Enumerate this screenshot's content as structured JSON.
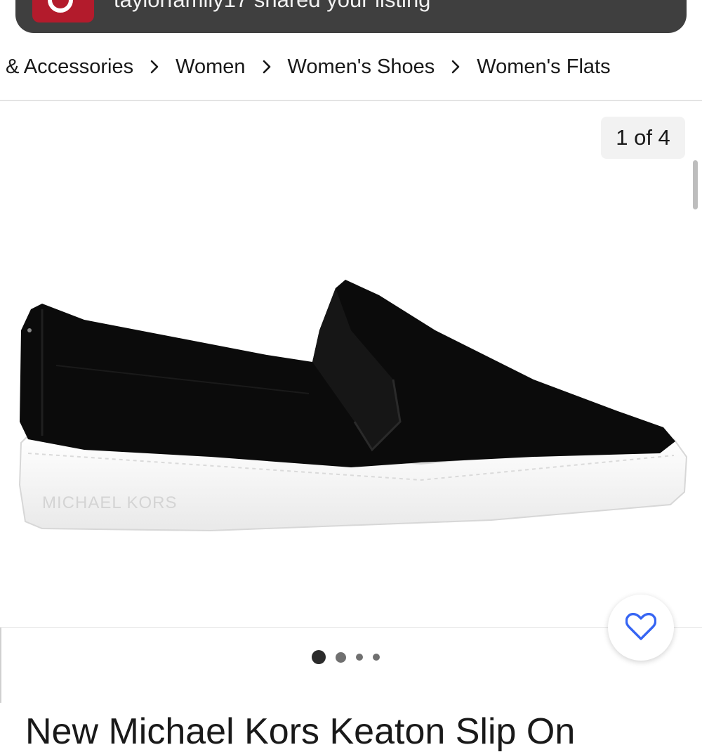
{
  "notification": {
    "text": "taylorfamily17 shared your listing"
  },
  "breadcrumb": [
    {
      "label": "& Accessories"
    },
    {
      "label": "Women"
    },
    {
      "label": "Women's Shoes"
    },
    {
      "label": "Women's Flats"
    }
  ],
  "gallery": {
    "counter": "1 of 4",
    "current_index": 1,
    "total": 4,
    "image_brand_text": "MICHAEL KORS"
  },
  "listing": {
    "title": "New Michael Kors Keaton Slip On"
  },
  "icons": {
    "notification_app": "app-icon",
    "breadcrumb_separator": "chevron-right-icon",
    "favorite": "heart-icon"
  },
  "colors": {
    "banner_bg": "#3f3f3f",
    "app_icon": "#b31b2c",
    "heart": "#3665f3",
    "active_dot": "#2b2b2b",
    "inactive_dot": "#707070"
  }
}
